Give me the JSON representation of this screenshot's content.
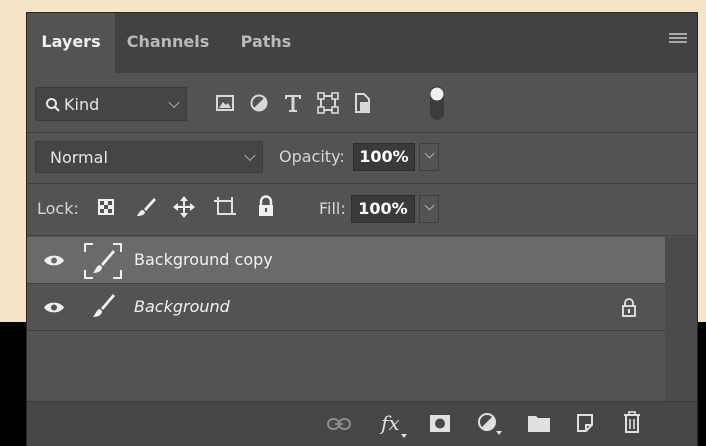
{
  "tabs": [
    {
      "label": "Layers",
      "active": true
    },
    {
      "label": "Channels",
      "active": false
    },
    {
      "label": "Paths",
      "active": false
    }
  ],
  "filter": {
    "label": "Kind"
  },
  "blend_mode": {
    "value": "Normal"
  },
  "opacity": {
    "label": "Opacity:",
    "value": "100%"
  },
  "lock": {
    "label": "Lock:"
  },
  "fill": {
    "label": "Fill:",
    "value": "100%"
  },
  "layers": [
    {
      "name": "Background copy",
      "selected": true,
      "visible": true,
      "italic": false,
      "locked": false
    },
    {
      "name": "Background",
      "selected": false,
      "visible": true,
      "italic": true,
      "locked": true
    }
  ],
  "colors": {
    "panel_bg": "#535353",
    "tab_bar_bg": "#424242",
    "selected_layer_bg": "#6a6a6a",
    "page_bg": "#f5e4c8"
  }
}
